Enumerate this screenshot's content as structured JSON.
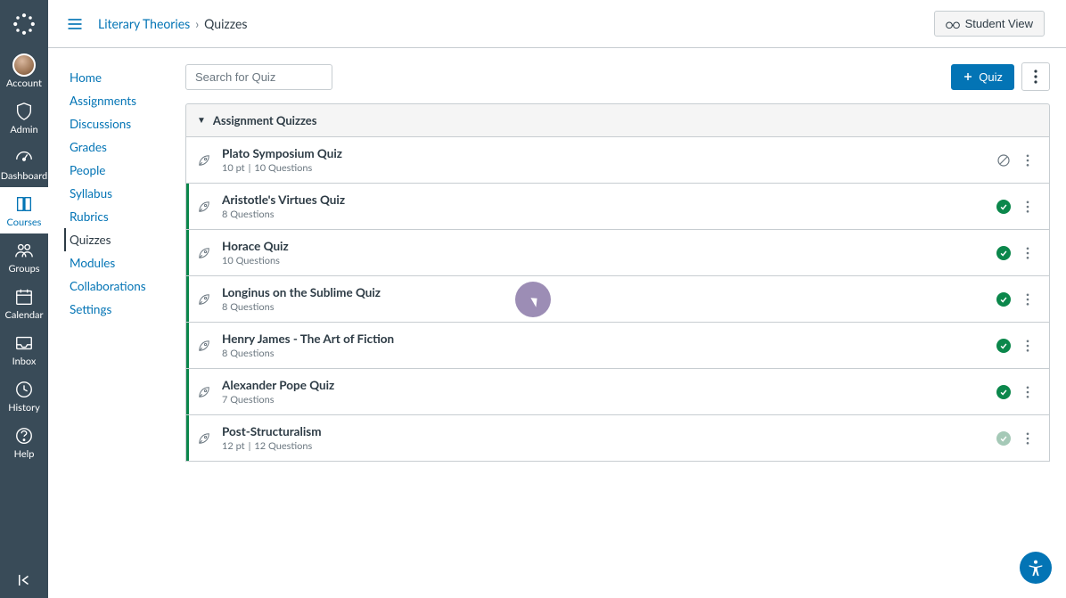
{
  "globalNav": {
    "items": [
      {
        "id": "account",
        "label": "Account",
        "icon": "avatar"
      },
      {
        "id": "admin",
        "label": "Admin",
        "icon": "shield"
      },
      {
        "id": "dashboard",
        "label": "Dashboard",
        "icon": "gauge"
      },
      {
        "id": "courses",
        "label": "Courses",
        "icon": "book",
        "active": true
      },
      {
        "id": "groups",
        "label": "Groups",
        "icon": "people"
      },
      {
        "id": "calendar",
        "label": "Calendar",
        "icon": "calendar"
      },
      {
        "id": "inbox",
        "label": "Inbox",
        "icon": "inbox"
      },
      {
        "id": "history",
        "label": "History",
        "icon": "clock"
      },
      {
        "id": "help",
        "label": "Help",
        "icon": "question"
      }
    ]
  },
  "breadcrumb": {
    "course": "Literary Theories",
    "current": "Quizzes"
  },
  "buttons": {
    "studentView": "Student View",
    "addQuiz": "Quiz"
  },
  "search": {
    "placeholder": "Search for Quiz"
  },
  "courseNav": {
    "items": [
      "Home",
      "Assignments",
      "Discussions",
      "Grades",
      "People",
      "Syllabus",
      "Rubrics",
      "Quizzes",
      "Modules",
      "Collaborations",
      "Settings"
    ],
    "activeIndex": 7
  },
  "section": {
    "title": "Assignment Quizzes"
  },
  "quizzes": [
    {
      "title": "Plato Symposium Quiz",
      "points": "10 pt",
      "questions": "10 Questions",
      "status": "unpublished"
    },
    {
      "title": "Aristotle's Virtues Quiz",
      "questions": "8 Questions",
      "status": "published"
    },
    {
      "title": "Horace Quiz",
      "questions": "10 Questions",
      "status": "published"
    },
    {
      "title": "Longinus on the Sublime Quiz",
      "questions": "8 Questions",
      "status": "published"
    },
    {
      "title": "Henry James - The Art of Fiction",
      "questions": "8 Questions",
      "status": "published"
    },
    {
      "title": "Alexander Pope Quiz",
      "questions": "7 Questions",
      "status": "published"
    },
    {
      "title": "Post-Structuralism",
      "points": "12 pt",
      "questions": "12 Questions",
      "status": "published-faded"
    }
  ]
}
